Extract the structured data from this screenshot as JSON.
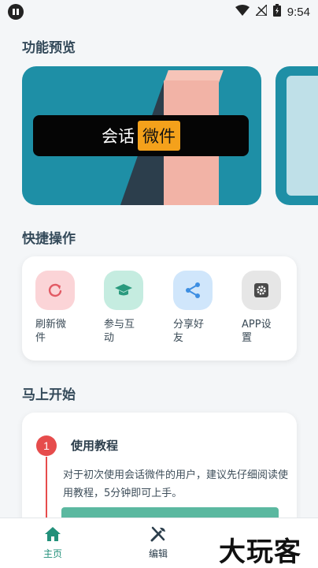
{
  "status_bar": {
    "time": "9:54",
    "icons": [
      "wifi-icon",
      "no-signal-icon",
      "battery-icon"
    ]
  },
  "sections": {
    "preview_title": "功能预览",
    "quick_title": "快捷操作",
    "start_title": "马上开始"
  },
  "preview": {
    "label_part1": "会话",
    "label_part2": "微件"
  },
  "quick_actions": [
    {
      "label": "刷新微件",
      "icon": "refresh-icon",
      "color": "#fbd4d7",
      "icon_color": "#e25a64"
    },
    {
      "label": "参与互动",
      "icon": "graduation-cap-icon",
      "color": "#c5ece0",
      "icon_color": "#2a9a7e"
    },
    {
      "label": "分享好友",
      "icon": "share-icon",
      "color": "#d0e6fb",
      "icon_color": "#3d8ee2"
    },
    {
      "label": "APP设置",
      "icon": "gear-icon",
      "color": "#e6e6e6",
      "icon_color": "#5a5a5a"
    }
  ],
  "steps": [
    {
      "number": "1",
      "title": "使用教程",
      "description": "对于初次使用会话微件的用户，建议先仔细阅读使用教程，5分钟即可上手。"
    }
  ],
  "bottom_nav": {
    "home": "主页",
    "edit": "编辑"
  },
  "watermark": "大玩客"
}
